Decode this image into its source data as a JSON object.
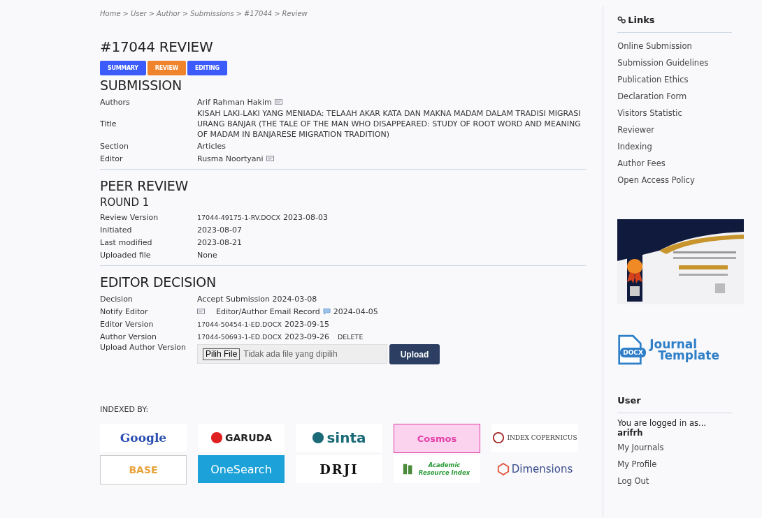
{
  "breadcrumb": [
    "Home",
    "User",
    "Author",
    "Submissions",
    "#17044",
    "Review"
  ],
  "breadcrumb_separator": ">",
  "title": "#17044 REVIEW",
  "tabs": [
    {
      "label": "SUMMARY",
      "selected": false
    },
    {
      "label": "REVIEW",
      "selected": true
    },
    {
      "label": "EDITING",
      "selected": false
    }
  ],
  "submission": {
    "heading": "SUBMISSION",
    "rows": [
      {
        "kind": "person",
        "label": "Authors",
        "value": "Arif Rahman Hakim"
      },
      {
        "kind": "text",
        "label": "Title",
        "value": "KISAH LAKI-LAKI YANG MENIADA: TELAAH AKAR KATA DAN MAKNA MADAM DALAM TRADISI MIGRASI URANG BANJAR (THE TALE OF THE MAN WHO DISAPPEARED: STUDY OF ROOT WORD AND MEANING OF MADAM IN BANJARESE MIGRATION TRADITION)"
      },
      {
        "kind": "text",
        "label": "Section",
        "value": "Articles"
      },
      {
        "kind": "person",
        "label": "Editor",
        "value": "Rusma Noortyani"
      }
    ]
  },
  "peer_review": {
    "heading": "PEER REVIEW",
    "round": "ROUND 1",
    "rows": [
      {
        "kind": "file",
        "label": "Review Version",
        "file": "17044-49175-1-RV.DOCX",
        "value": "2023-08-03"
      },
      {
        "kind": "text",
        "label": "Initiated",
        "value": "2023-08-07"
      },
      {
        "kind": "text",
        "label": "Last modified",
        "value": "2023-08-21"
      },
      {
        "kind": "text",
        "label": "Uploaded file",
        "value": "None"
      }
    ]
  },
  "editor_decision": {
    "heading": "EDITOR DECISION",
    "rows": [
      {
        "kind": "text",
        "label": "Decision",
        "value": "Accept Submission 2024-03-08"
      },
      {
        "kind": "notify",
        "label": "Notify Editor",
        "value": "Editor/Author Email Record",
        "date": "2024-04-05"
      },
      {
        "kind": "file",
        "label": "Editor Version",
        "file": "17044-50454-1-ED.DOCX",
        "value": "2023-09-15"
      },
      {
        "kind": "file",
        "label": "Author Version",
        "file": "17044-50693-1-ED.DOCX",
        "value": "2023-09-26",
        "action": "DELETE"
      },
      {
        "kind": "upload",
        "label": "Upload Author Version",
        "choose": "Pilih File",
        "status": "Tidak ada file yang dipilih",
        "button": "Upload"
      }
    ]
  },
  "indexed_by": {
    "label": "INDEXED BY:",
    "logos": [
      {
        "kind": "google",
        "text": "Google",
        "color": "#2a4fb0"
      },
      {
        "kind": "garuda",
        "text": "GARUDA",
        "color": "#222222"
      },
      {
        "kind": "sinta",
        "text": "sinta",
        "color": "#1b6a78"
      },
      {
        "kind": "cosmos",
        "text": "Cosmos",
        "color": "#e23fa8"
      },
      {
        "kind": "copernicus",
        "text": "INDEX COPERNICUS",
        "color": "#333333"
      },
      {
        "kind": "base",
        "text": "BASE",
        "color": "#e8a33a"
      },
      {
        "kind": "onesearch",
        "text": "OneSearch",
        "color": "#ffffff"
      },
      {
        "kind": "drji",
        "text": "DRJI",
        "color": "#111111"
      },
      {
        "kind": "researchbib",
        "text": "Academic Resource Index",
        "color": "#2e9b3a"
      },
      {
        "kind": "dimensions",
        "text": "Dimensions",
        "color": "#3b4d8c"
      }
    ]
  },
  "sidebar": {
    "links_heading": "Links",
    "links": [
      "Online Submission",
      "Submission Guidelines",
      "Publication Ethics",
      "Declaration Form",
      "Visitors Statistic",
      "Reviewer",
      "Indexing",
      "Author Fees",
      "Open Access Policy"
    ],
    "certificate": {
      "kind": "picture"
    },
    "template": {
      "badge": "DOCX",
      "line1": "Journal",
      "line2": "Template"
    },
    "user_heading": "User",
    "logged_in": "You are logged in as...",
    "username": "arifrh",
    "user_links": [
      "My Journals",
      "My Profile",
      "Log Out"
    ]
  }
}
